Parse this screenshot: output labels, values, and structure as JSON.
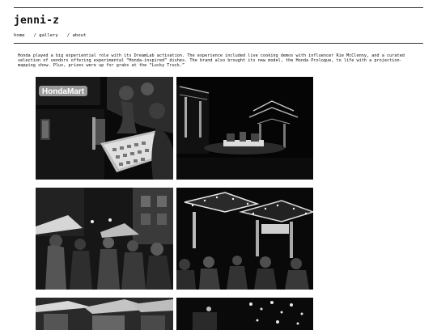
{
  "site": {
    "title": "jenni-z"
  },
  "nav": {
    "items": [
      {
        "label": "home"
      },
      {
        "label": "/ gallery"
      },
      {
        "label": "/ about"
      }
    ]
  },
  "post": {
    "body": "Honda played a big experiential role with its DreamLab activation. The experience included live cooking demos with influencer Rie McClenny, and a curated selection of vendors offering experimental “Honda-inspired” dishes. The brand also brought its new model, the Honda Prologue, to life with a projection-mapping show. Plus, prizes were up for grabs at the “Lucky Truck.”"
  },
  "gallery": {
    "photos": [
      {
        "sign_text": "HondaMart"
      },
      {},
      {},
      {},
      {},
      {}
    ]
  }
}
